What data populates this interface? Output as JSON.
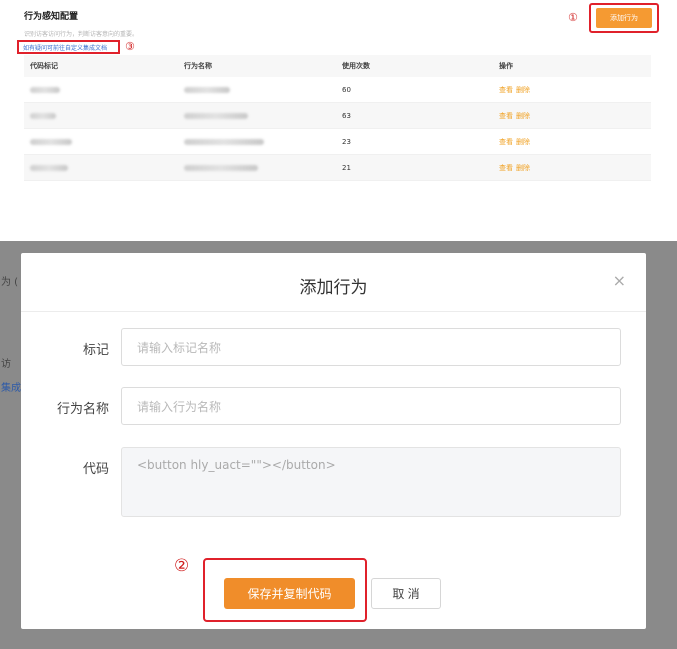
{
  "config_page": {
    "title": "行为感知配置",
    "description": "识别访客访问行为，判断访客意向的重要。",
    "doc_link": "如有疑问可前往自定义集成文档",
    "add_button": "添加行为",
    "markers": {
      "add": "①",
      "doc": "③"
    },
    "table": {
      "headers": [
        "代码标记",
        "行为名称",
        "使用次数",
        "操作"
      ],
      "rows": [
        {
          "count": "60",
          "view": "查看",
          "delete": "删除"
        },
        {
          "count": "63",
          "view": "查看",
          "delete": "删除"
        },
        {
          "count": "23",
          "view": "查看",
          "delete": "删除"
        },
        {
          "count": "21",
          "view": "查看",
          "delete": "删除"
        }
      ]
    }
  },
  "background_fragments": [
    "为 (",
    "访",
    "集成"
  ],
  "dialog": {
    "title": "添加行为",
    "close_icon": "×",
    "fields": {
      "mark_label": "标记",
      "mark_placeholder": "请输入标记名称",
      "name_label": "行为名称",
      "name_placeholder": "请输入行为名称",
      "code_label": "代码",
      "code_value": "<button hly_uact=\"\"></button>"
    },
    "save_button": "保存并复制代码",
    "cancel_button": "取 消",
    "marker_save": "②"
  },
  "colors": {
    "accent_orange": "#f59a32",
    "link_blue": "#3a6fd0",
    "annotation_red": "#e0212b",
    "overlay_gray": "#8a8a8a"
  }
}
